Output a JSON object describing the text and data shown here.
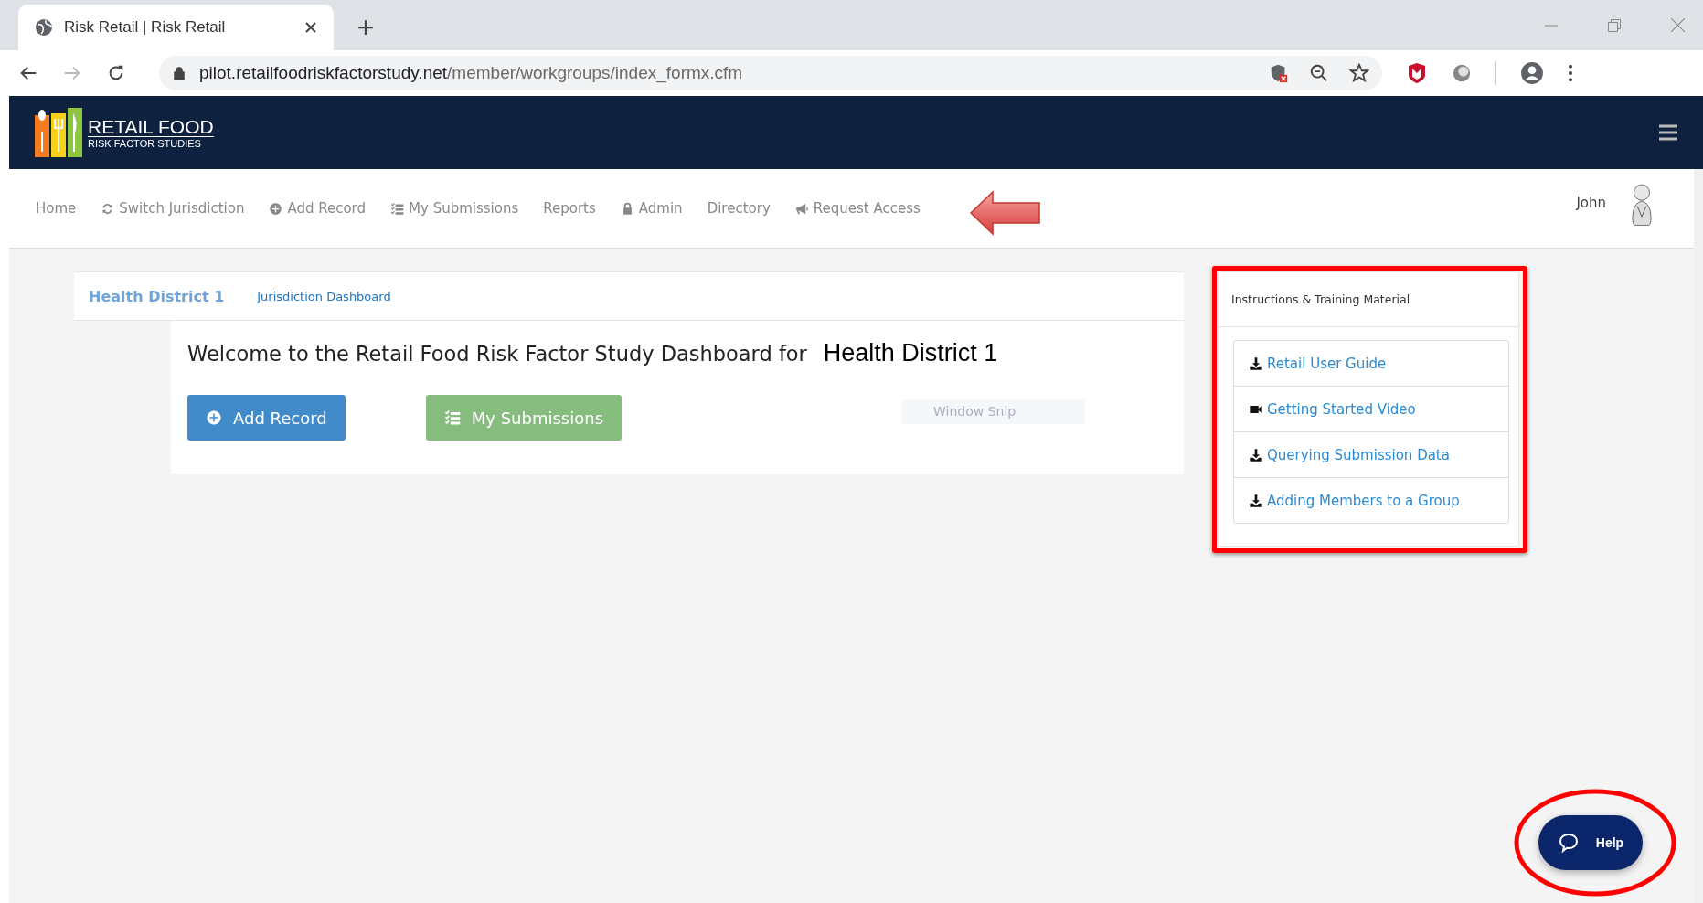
{
  "browser": {
    "tab_title": "Risk Retail | Risk Retail",
    "url_host": "pilot.retailfoodriskfactorstudy.net",
    "url_path": "/member/workgroups/index_formx.cfm"
  },
  "header": {
    "logo_line1": "RETAIL FOOD",
    "logo_line2": "RISK FACTOR STUDIES"
  },
  "nav": {
    "items": [
      {
        "label": "Home"
      },
      {
        "label": "Switch Jurisdiction"
      },
      {
        "label": "Add Record"
      },
      {
        "label": "My Submissions"
      },
      {
        "label": "Reports"
      },
      {
        "label": "Admin"
      },
      {
        "label": "Directory"
      },
      {
        "label": "Request Access"
      }
    ],
    "user": "John"
  },
  "dashboard": {
    "tabs": [
      {
        "label": "Health District 1",
        "selected": true
      },
      {
        "label": "Jurisdiction Dashboard",
        "selected": false
      }
    ],
    "welcome": "Welcome to the Retail Food Risk Factor Study Dashboard for",
    "district": "Health District 1",
    "buttons": [
      {
        "label": "Add Record",
        "kind": "primary"
      },
      {
        "label": "My Submissions",
        "kind": "success"
      }
    ],
    "ghost_text": "Window Snip"
  },
  "training": {
    "title": "Instructions & Training Material",
    "links": [
      {
        "label": "Retail User Guide",
        "kind": "download"
      },
      {
        "label": "Getting Started Video",
        "kind": "video"
      },
      {
        "label": "Querying Submission Data",
        "kind": "download"
      },
      {
        "label": "Adding Members to a Group",
        "kind": "download"
      }
    ]
  },
  "help": {
    "label": "Help"
  }
}
